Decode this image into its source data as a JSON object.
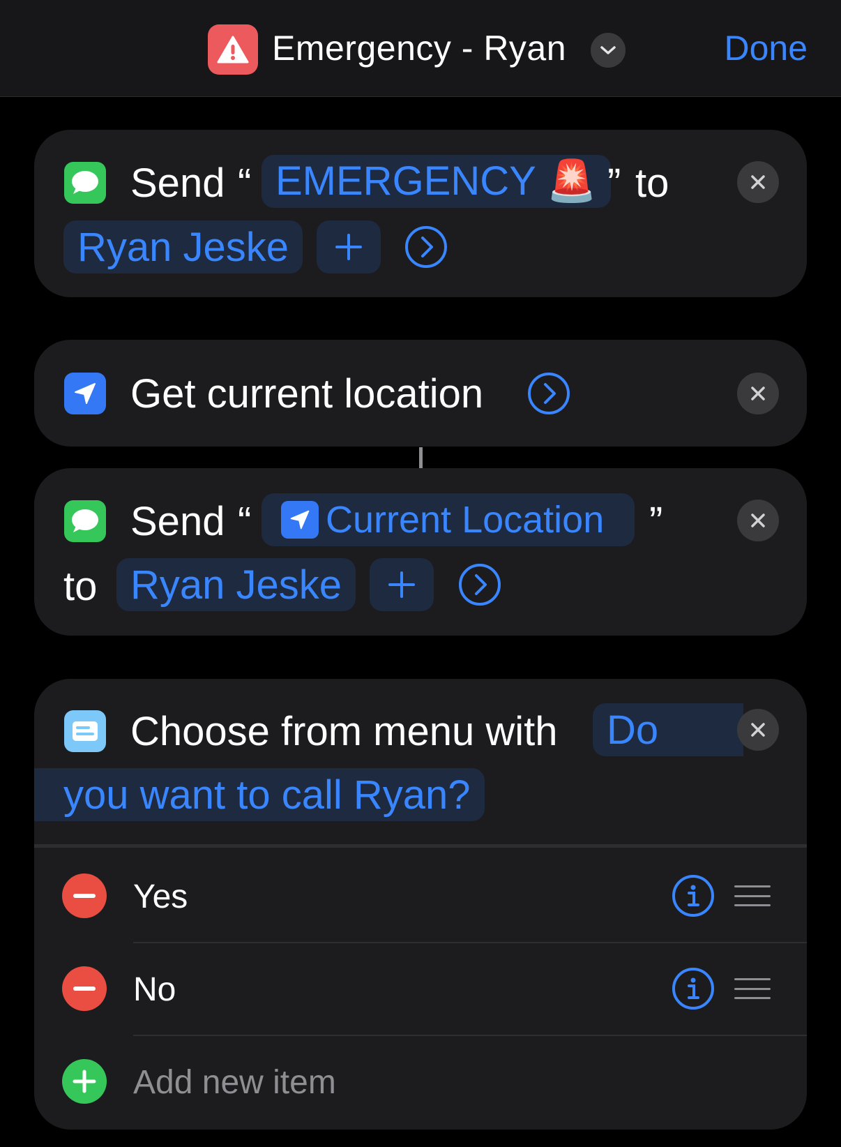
{
  "header": {
    "title": "Emergency - Ryan",
    "done_label": "Done",
    "app_icon": "warning-triangle-icon",
    "accent_color": "#3a86ff",
    "app_icon_color": "#ec5a5e"
  },
  "actions": [
    {
      "icon": "messages-icon",
      "verb": "Send",
      "open_quote": "“",
      "message": "EMERGENCY 🚨",
      "close_quote": "”",
      "to_label": "to",
      "recipient": "Ryan Jeske"
    },
    {
      "icon": "location-arrow-icon",
      "label": "Get current location"
    },
    {
      "icon": "messages-icon",
      "verb": "Send",
      "open_quote": "“",
      "message": "Current Location",
      "close_quote": "”",
      "to_label": "to",
      "recipient": "Ryan Jeske"
    },
    {
      "icon": "menu-card-icon",
      "label": "Choose from menu with",
      "prompt_part1": "Do",
      "prompt_part2": "you want to call Ryan?",
      "items": [
        {
          "label": "Yes"
        },
        {
          "label": "No"
        }
      ],
      "add_item_label": "Add new item"
    }
  ]
}
